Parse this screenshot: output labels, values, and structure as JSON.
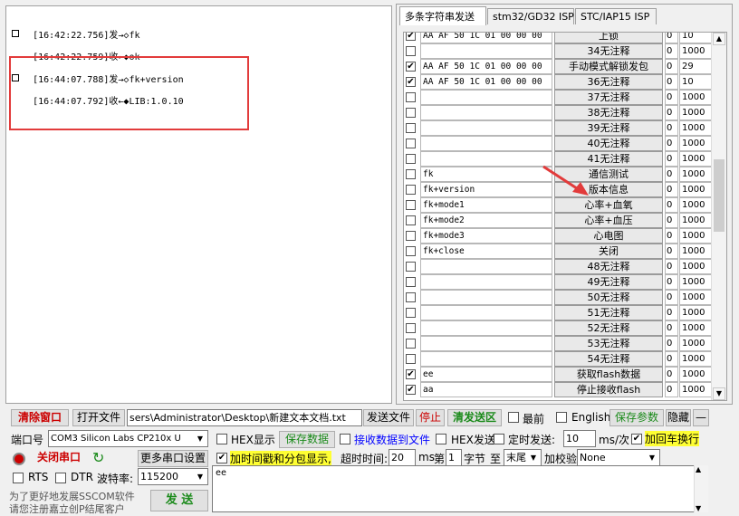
{
  "receive": {
    "lines": [
      {
        "time": "[16:42:22.756]",
        "dir": "发→◇",
        "text": "fk"
      },
      {
        "time": "[16:42:22.759]",
        "dir": "收←◆",
        "text": "ok"
      },
      {
        "time": "[16:44:07.788]",
        "dir": "发→◇",
        "text": "fk+version"
      },
      {
        "time": "[16:44:07.792]",
        "dir": "收←◆",
        "text": "LIB:1.0.10"
      }
    ]
  },
  "tabs": [
    "多条字符串发送",
    "stm32/GD32 ISP",
    "STC/IAP15 ISP"
  ],
  "multi": {
    "rows": [
      {
        "checked": true,
        "hex": "AA AF 50 1C 01 00 00 00",
        "label": "上锁",
        "n": "0",
        "delay": "10"
      },
      {
        "checked": false,
        "hex": "",
        "label": "34无注释",
        "n": "0",
        "delay": "1000"
      },
      {
        "checked": true,
        "hex": "AA AF 50 1C 01 00 00 00",
        "label": "手动模式解锁发包",
        "n": "0",
        "delay": "29"
      },
      {
        "checked": true,
        "hex": "AA AF 50 1C 01 00 00 00",
        "label": "36无注释",
        "n": "0",
        "delay": "10"
      },
      {
        "checked": false,
        "hex": "",
        "label": "37无注释",
        "n": "0",
        "delay": "1000"
      },
      {
        "checked": false,
        "hex": "",
        "label": "38无注释",
        "n": "0",
        "delay": "1000"
      },
      {
        "checked": false,
        "hex": "",
        "label": "39无注释",
        "n": "0",
        "delay": "1000"
      },
      {
        "checked": false,
        "hex": "",
        "label": "40无注释",
        "n": "0",
        "delay": "1000"
      },
      {
        "checked": false,
        "hex": "",
        "label": "41无注释",
        "n": "0",
        "delay": "1000"
      },
      {
        "checked": false,
        "hex": "fk",
        "label": "通信测试",
        "n": "0",
        "delay": "1000"
      },
      {
        "checked": false,
        "hex": "fk+version",
        "label": "版本信息",
        "n": "0",
        "delay": "1000"
      },
      {
        "checked": false,
        "hex": "fk+mode1",
        "label": "心率+血氧",
        "n": "0",
        "delay": "1000"
      },
      {
        "checked": false,
        "hex": "fk+mode2",
        "label": "心率+血压",
        "n": "0",
        "delay": "1000"
      },
      {
        "checked": false,
        "hex": "fk+mode3",
        "label": "心电图",
        "n": "0",
        "delay": "1000"
      },
      {
        "checked": false,
        "hex": "fk+close",
        "label": "关闭",
        "n": "0",
        "delay": "1000"
      },
      {
        "checked": false,
        "hex": "",
        "label": "48无注释",
        "n": "0",
        "delay": "1000"
      },
      {
        "checked": false,
        "hex": "",
        "label": "49无注释",
        "n": "0",
        "delay": "1000"
      },
      {
        "checked": false,
        "hex": "",
        "label": "50无注释",
        "n": "0",
        "delay": "1000"
      },
      {
        "checked": false,
        "hex": "",
        "label": "51无注释",
        "n": "0",
        "delay": "1000"
      },
      {
        "checked": false,
        "hex": "",
        "label": "52无注释",
        "n": "0",
        "delay": "1000"
      },
      {
        "checked": false,
        "hex": "",
        "label": "53无注释",
        "n": "0",
        "delay": "1000"
      },
      {
        "checked": false,
        "hex": "",
        "label": "54无注释",
        "n": "0",
        "delay": "1000"
      },
      {
        "checked": true,
        "hex": "ee",
        "label": "获取flash数据",
        "n": "0",
        "delay": "1000"
      },
      {
        "checked": true,
        "hex": "aa",
        "label": "停止接收flash",
        "n": "0",
        "delay": "1000"
      }
    ]
  },
  "toolbar": {
    "clear_window": "清除窗口",
    "open_file": "打开文件",
    "file_path": "sers\\Administrator\\Desktop\\新建文本文档.txt",
    "send_file": "发送文件",
    "stop": "停止",
    "clear_send": "清发送区",
    "latest": "最前",
    "english": "English",
    "save_params": "保存参数",
    "hide": "隐藏",
    "minus": "—"
  },
  "port": {
    "port_label": "端口号",
    "port_value": "COM3 Silicon Labs CP210x U",
    "hex_display": "HEX显示",
    "save_data": "保存数据",
    "recv_to_file": "接收数据到文件",
    "hex_send": "HEX发送",
    "timed_send": "定时发送:",
    "interval": "10",
    "interval_unit": "ms/次",
    "add_crlf": "加回车换行",
    "close_port": "关闭串口",
    "more_settings": "更多串口设置",
    "timestamp": "加时间戳和分包显示,",
    "timeout_label": "超时时间:",
    "timeout_value": "20",
    "ms": "ms",
    "byte_idx_pre": "第",
    "byte_idx": "1",
    "byte_idx_post": "字节",
    "to": "至",
    "tail": "末尾",
    "checksum": "加校验",
    "checksum_value": "None",
    "rts": "RTS",
    "dtr": "DTR",
    "baud_label": "波特率:",
    "baud_value": "115200",
    "send_text": "ee",
    "promo1": "为了更好地发展SSCOM软件",
    "promo2": "请您注册嘉立创P结尾客户",
    "send_btn": "发 送"
  },
  "colors": {
    "highlight": "#e23b3b",
    "arrow": "#e23b3b",
    "yellow": "#ffff33"
  }
}
